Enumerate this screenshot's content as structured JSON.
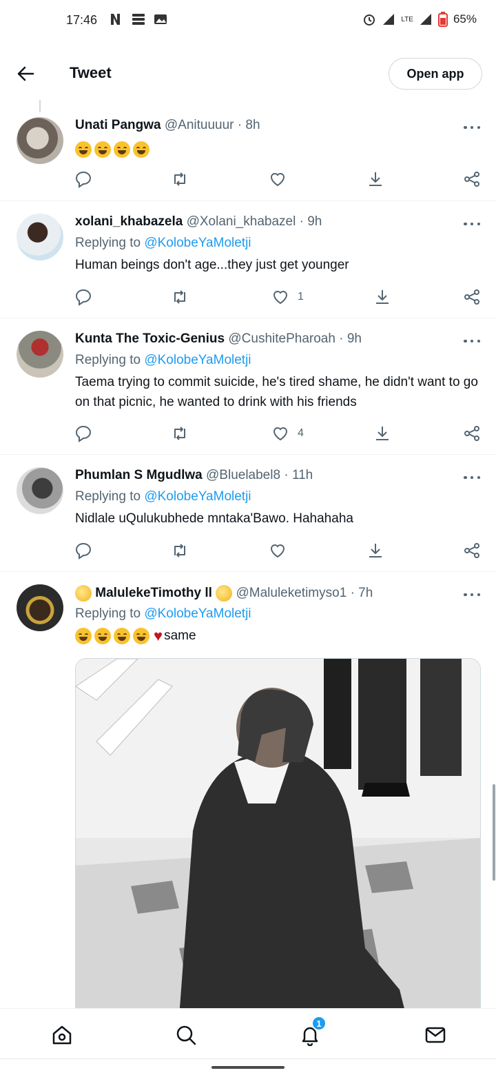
{
  "status_bar": {
    "time": "17:46",
    "battery": "65%",
    "network": "LTE"
  },
  "header": {
    "title": "Tweet",
    "open_app_label": "Open app"
  },
  "tweets": [
    {
      "name": "Unati Pangwa",
      "handle": "@Anituuuur",
      "time": "8h",
      "replying_prefix": "",
      "replying_to": "",
      "text": "",
      "emojis": 4,
      "likes": ""
    },
    {
      "name": "xolani_khabazela",
      "handle": "@Xolani_khabazel",
      "time": "9h",
      "replying_prefix": "Replying to",
      "replying_to": "@KolobeYaMoletji",
      "text": "Human beings don't age...they just get younger",
      "likes": "1"
    },
    {
      "name": "Kunta The Toxic-Genius",
      "handle": "@CushitePharoah",
      "time": "9h",
      "replying_prefix": "Replying to",
      "replying_to": "@KolobeYaMoletji",
      "text": "Taema trying to commit suicide, he's tired shame, he didn't want to go on that picnic, he wanted to drink with his friends",
      "likes": "4"
    },
    {
      "name": "Phumlan S Mgudlwa",
      "handle": "@Bluelabel8",
      "time": "11h",
      "replying_prefix": "Replying to",
      "replying_to": "@KolobeYaMoletji",
      "text": "Nidlale uQulukubhede mntaka'Bawo. Hahahaha",
      "likes": ""
    },
    {
      "name": "MalulekeTimothy ll",
      "handle": "@Maluleketimyso1",
      "time": "7h",
      "replying_prefix": "Replying to",
      "replying_to": "@KolobeYaMoletji",
      "text": "same",
      "likes": ""
    }
  ],
  "separator": "·",
  "bottom_nav": {
    "notification_count": "1",
    "items": [
      "home-icon",
      "search-icon",
      "bell-icon",
      "mail-icon"
    ]
  },
  "colors": {
    "accent": "#1d9bf0",
    "text": "#0f1419",
    "muted": "#536471",
    "border": "#eff3f4"
  }
}
